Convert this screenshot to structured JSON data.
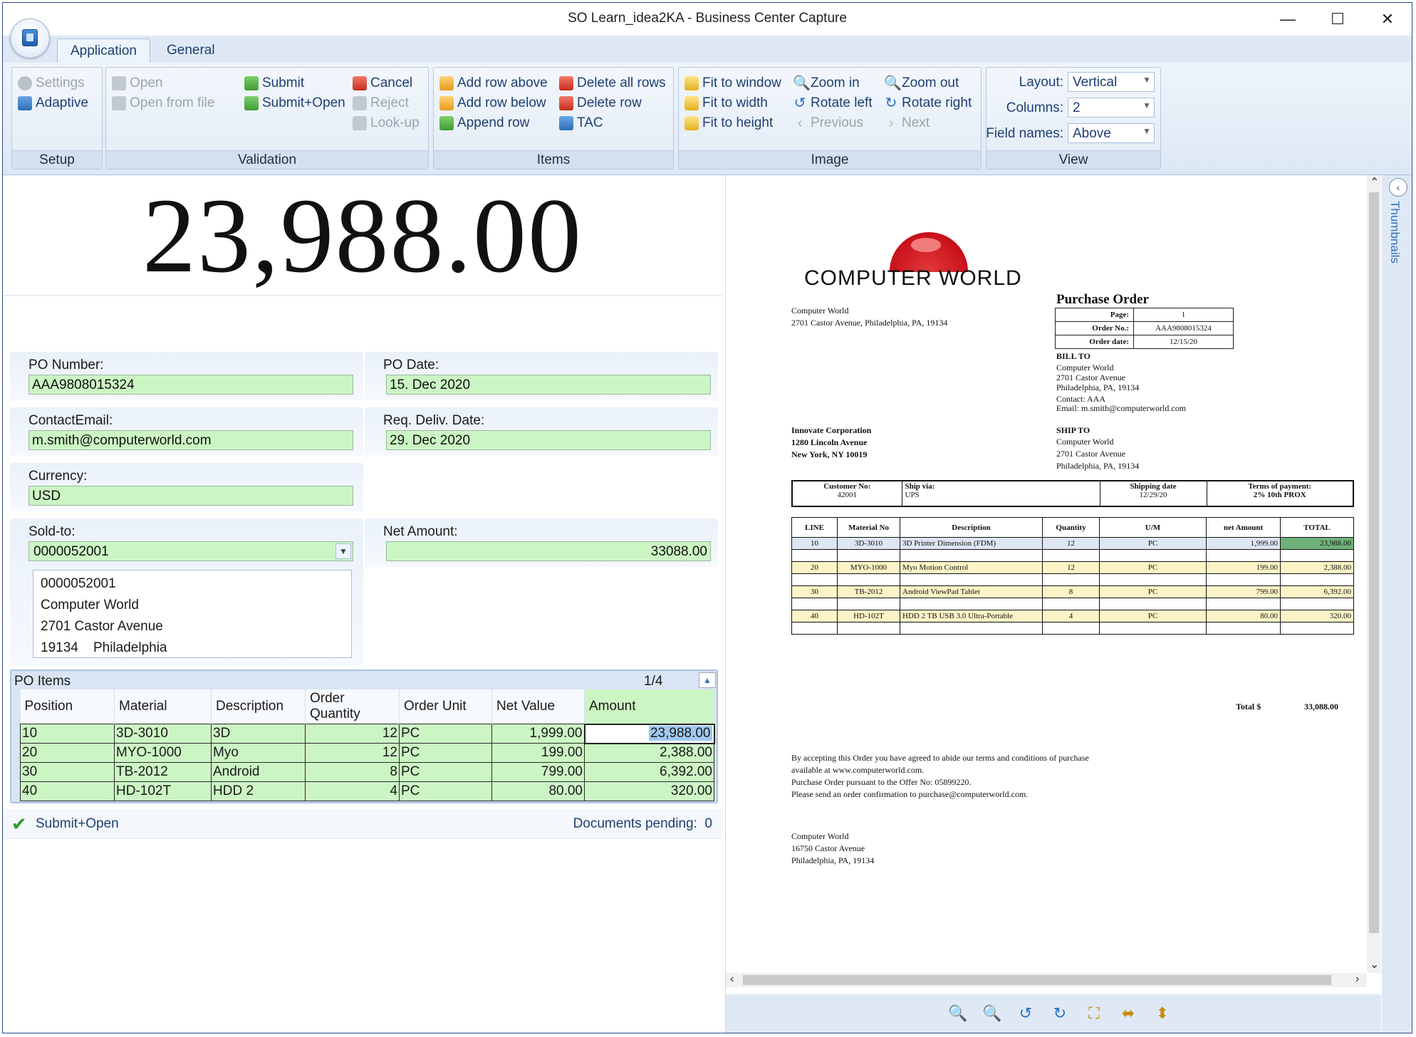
{
  "window": {
    "title": "SO Learn_idea2KA - Business Center Capture",
    "minimize": "—",
    "maximize": "☐",
    "close": "✕"
  },
  "tabs": [
    {
      "label": "Application",
      "active": true
    },
    {
      "label": "General",
      "active": false
    }
  ],
  "ribbon": {
    "setup": {
      "label": "Setup",
      "settings": "Settings",
      "adaptive": "Adaptive"
    },
    "validation": {
      "label": "Validation",
      "open": "Open",
      "open_from_file": "Open from file",
      "submit": "Submit",
      "submit_open": "Submit+Open",
      "cancel": "Cancel",
      "reject": "Reject",
      "lookup": "Look-up"
    },
    "items": {
      "label": "Items",
      "add_row_above": "Add row above",
      "add_row_below": "Add row below",
      "append_row": "Append row",
      "delete_all_rows": "Delete all rows",
      "delete_row": "Delete row",
      "tac": "TAC"
    },
    "image": {
      "label": "Image",
      "fit_to_window": "Fit to window",
      "fit_to_width": "Fit to width",
      "fit_to_height": "Fit to height",
      "zoom_in": "Zoom in",
      "rotate_left": "Rotate left",
      "previous": "Previous",
      "zoom_out": "Zoom out",
      "rotate_right": "Rotate right",
      "next": "Next"
    },
    "view": {
      "label": "View",
      "layout_label": "Layout:",
      "layout_value": "Vertical",
      "columns_label": "Columns:",
      "columns_value": "2",
      "field_names_label": "Field names:",
      "field_names_value": "Above"
    }
  },
  "form": {
    "big_amount": "23,988.00",
    "po_number": {
      "label": "PO Number:",
      "value": "AAA9808015324"
    },
    "po_date": {
      "label": "PO Date:",
      "value": "15. Dec 2020"
    },
    "contact_email": {
      "label": "ContactEmail:",
      "value": "m.smith@computerworld.com"
    },
    "req_deliv_date": {
      "label": "Req. Deliv. Date:",
      "value": "29. Dec 2020"
    },
    "currency": {
      "label": "Currency:",
      "value": "USD"
    },
    "sold_to": {
      "label": "Sold-to:",
      "value": "0000052001",
      "address": {
        "id": "0000052001",
        "name": "Computer World",
        "street": "2701 Castor Avenue",
        "zip": "19134",
        "city": "Philadelphia"
      }
    },
    "net_amount": {
      "label": "Net Amount:",
      "value": "33088.00"
    }
  },
  "po_items": {
    "title": "PO Items",
    "page": "1/4",
    "columns": [
      "Position",
      "Material",
      "Description",
      "Order Quantity",
      "Order Unit",
      "Net Value",
      "Amount"
    ],
    "rows": [
      [
        "10",
        "3D-3010",
        "3D",
        "12",
        "PC",
        "1,999.00",
        "23,988.00"
      ],
      [
        "20",
        "MYO-1000",
        "Myo",
        "12",
        "PC",
        "199.00",
        "2,388.00"
      ],
      [
        "30",
        "TB-2012",
        "Android",
        "8",
        "PC",
        "799.00",
        "6,392.00"
      ],
      [
        "40",
        "HD-102T",
        "HDD 2",
        "4",
        "PC",
        "80.00",
        "320.00"
      ]
    ]
  },
  "status": {
    "action": "Submit+Open",
    "pending_label": "Documents pending:",
    "pending_count": "0"
  },
  "viewer": {
    "thumbnails_label": "Thumbnails"
  },
  "document": {
    "logo": "COMPUTER WORLD",
    "sender": [
      "Computer World",
      "2701 Castor Avenue, Philadelphia, PA, 19134"
    ],
    "title": "Purchase Order",
    "info": [
      {
        "k": "Page:",
        "v": "1"
      },
      {
        "k": "Order No.:",
        "v": "AAA9808015324"
      },
      {
        "k": "Order date:",
        "v": "12/15/20"
      }
    ],
    "bill_to": {
      "heading": "BILL TO",
      "lines": [
        "Computer World",
        "2701 Castor Avenue",
        "Philadelphia, PA, 19134",
        "Contact: AAA",
        "Email: m.smith@computerworld.com"
      ]
    },
    "vendor": [
      "Innovate Corporation",
      "1280 Lincoln Avenue",
      "New York, NY 10019"
    ],
    "ship_to": {
      "heading": "SHIP TO",
      "lines": [
        "Computer World",
        "2701 Castor Avenue",
        "Philadelphia, PA, 19134"
      ]
    },
    "ship": {
      "customer_no_label": "Customer No:",
      "customer_no": "42001",
      "ship_via_label": "Ship via:",
      "ship_via": "UPS",
      "shipping_date_label": "Shipping date",
      "shipping_date": "12/29/20",
      "terms_label": "Terms of payment:",
      "terms": "2% 10th PROX"
    },
    "line_headers": [
      "LINE",
      "Material No",
      "Description",
      "Quantity",
      "U/M",
      "net Amount",
      "TOTAL"
    ],
    "lines": [
      [
        "10",
        "3D-3010",
        "3D Printer Dimension (FDM)",
        "12",
        "PC",
        "1,999.00",
        "23,988.00"
      ],
      [
        "20",
        "MYO-1000",
        "Myo Motion Control",
        "12",
        "PC",
        "199.00",
        "2,388.00"
      ],
      [
        "30",
        "TB-2012",
        "Android ViewPad Tablet",
        "8",
        "PC",
        "799.00",
        "6,392.00"
      ],
      [
        "40",
        "HD-102T",
        "HDD 2 TB USB 3.0 Ultra-Portable",
        "4",
        "PC",
        "80.00",
        "320.00"
      ]
    ],
    "total_label": "Total  $",
    "total": "33,088.00",
    "terms_text": [
      "By accepting this Order you have agreed to abide our terms and conditions of purchase",
      "available at www.computerworld.com.",
      "Purchase Order pursuant to the Offer No: 05899220.",
      "Please send an order confirmation to purchase@computerworld.com."
    ],
    "footer": [
      "Computer World",
      "16750 Castor Avenue",
      "Philadelphia, PA, 19134"
    ]
  }
}
